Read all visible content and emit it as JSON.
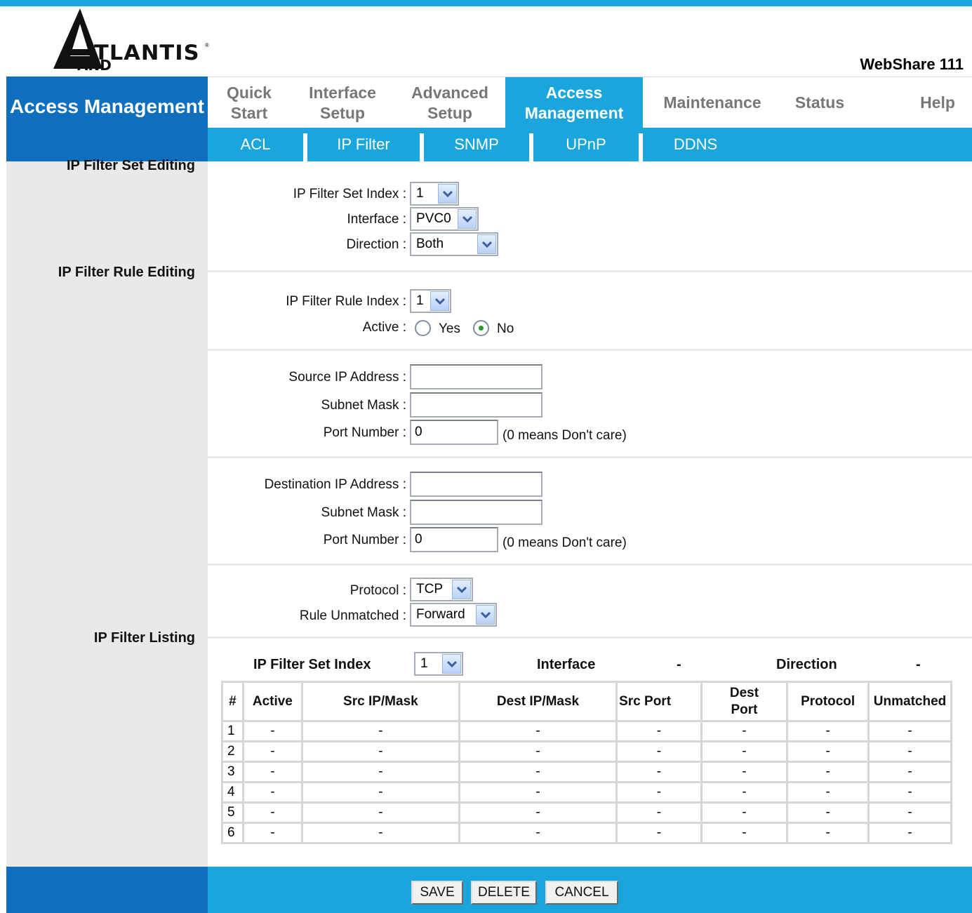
{
  "brand": {
    "logo_word": "TLANTIS",
    "logo_sub": "AND",
    "logo_mark": "®",
    "product": "WebShare 111"
  },
  "page_title": "Access Management",
  "nav": {
    "items": [
      {
        "label": "Quick\nStart"
      },
      {
        "label": "Interface\nSetup"
      },
      {
        "label": "Advanced\nSetup"
      },
      {
        "label": "Access\nManagement"
      },
      {
        "label": "Maintenance"
      },
      {
        "label": "Status"
      },
      {
        "label": "Help"
      }
    ],
    "active_index": 3
  },
  "subnav": {
    "items": [
      "ACL",
      "IP Filter",
      "SNMP",
      "UPnP",
      "DDNS"
    ],
    "active": "IP Filter"
  },
  "sections": {
    "set_editing": "IP Filter Set Editing",
    "rule_editing": "IP Filter Rule Editing",
    "listing": "IP Filter Listing"
  },
  "set_editing": {
    "set_index_label": "IP Filter Set Index :",
    "set_index_value": "1",
    "interface_label": "Interface :",
    "interface_value": "PVC0",
    "direction_label": "Direction :",
    "direction_value": "Both"
  },
  "rule_editing": {
    "rule_index_label": "IP Filter Rule Index :",
    "rule_index_value": "1",
    "active_label": "Active :",
    "active_yes": "Yes",
    "active_no": "No",
    "active_selected": "No",
    "src_ip_label": "Source IP Address :",
    "src_ip_value": "",
    "src_mask_label": "Subnet Mask :",
    "src_mask_value": "",
    "src_port_label": "Port Number :",
    "src_port_value": "0",
    "src_port_hint": "(0 means Don't care)",
    "dst_ip_label": "Destination IP Address :",
    "dst_ip_value": "",
    "dst_mask_label": "Subnet Mask :",
    "dst_mask_value": "",
    "dst_port_label": "Port Number :",
    "dst_port_value": "0",
    "dst_port_hint": "(0 means Don't care)",
    "protocol_label": "Protocol :",
    "protocol_value": "TCP",
    "unmatched_label": "Rule Unmatched :",
    "unmatched_value": "Forward"
  },
  "listing": {
    "set_index_label": "IP Filter Set Index",
    "set_index_value": "1",
    "interface_label": "Interface",
    "interface_value": "-",
    "direction_label": "Direction",
    "direction_value": "-",
    "columns": [
      "#",
      "Active",
      "Src IP/Mask",
      "Dest IP/Mask",
      "Src Port",
      "Dest\nPort",
      "Protocol",
      "Unmatched"
    ],
    "rows": [
      [
        "1",
        "-",
        "-",
        "-",
        "-",
        "-",
        "-",
        "-"
      ],
      [
        "2",
        "-",
        "-",
        "-",
        "-",
        "-",
        "-",
        "-"
      ],
      [
        "3",
        "-",
        "-",
        "-",
        "-",
        "-",
        "-",
        "-"
      ],
      [
        "4",
        "-",
        "-",
        "-",
        "-",
        "-",
        "-",
        "-"
      ],
      [
        "5",
        "-",
        "-",
        "-",
        "-",
        "-",
        "-",
        "-"
      ],
      [
        "6",
        "-",
        "-",
        "-",
        "-",
        "-",
        "-",
        "-"
      ]
    ]
  },
  "buttons": {
    "save": "SAVE",
    "delete": "DELETE",
    "cancel": "CANCEL"
  },
  "colors": {
    "accent": "#1aa6dd",
    "brand_blue": "#0f6fbf",
    "sidebar_gray": "#e9e9e9",
    "nav_text_gray": "#777777"
  },
  "icons": {
    "dropdown": "chevron-down-icon",
    "logo": "atlantis-logo"
  }
}
